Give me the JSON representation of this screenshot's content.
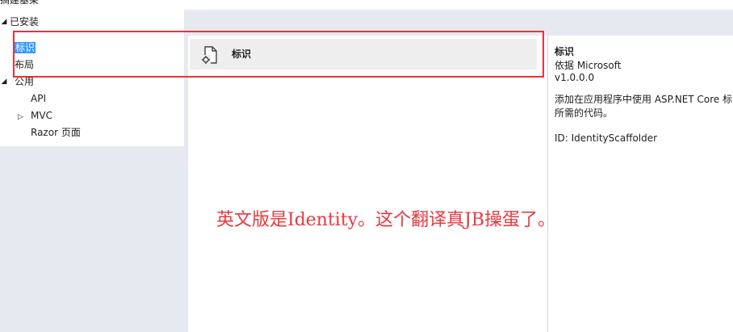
{
  "window": {
    "clipped_title": "搞建基架"
  },
  "tree": {
    "installed_label": "已安装",
    "items": [
      {
        "label": "标识",
        "selected": true
      },
      {
        "label": "布局"
      }
    ],
    "common_label": "公用",
    "common_children": [
      {
        "label": "API"
      },
      {
        "label": "MVC"
      },
      {
        "label": "Razor 页面"
      }
    ]
  },
  "templates": [
    {
      "name": "标识",
      "icon": "scaffold-page-icon"
    }
  ],
  "details": {
    "title": "标识",
    "by": "依据 Microsoft",
    "version": "v1.0.0.0",
    "desc_line1": "添加在应用程序中使用 ASP.NET Core 标",
    "desc_line2": "所需的代码。",
    "id": "ID: IdentityScaffolder"
  },
  "annotation": {
    "text": "英文版是Identity。这个翻译真JB操蛋了。",
    "color": "#e8383d"
  }
}
